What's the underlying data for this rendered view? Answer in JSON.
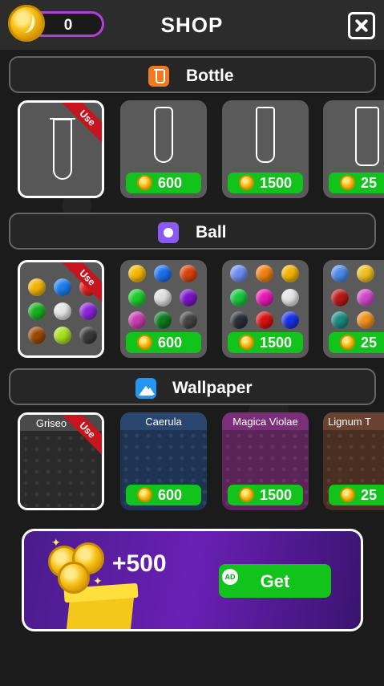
{
  "header": {
    "coin_count": "0",
    "title": "SHOP"
  },
  "sections": {
    "bottle": {
      "label": "Bottle",
      "items": [
        {
          "badge": "Use"
        },
        {
          "price": "600"
        },
        {
          "price": "1500"
        },
        {
          "price": "25"
        }
      ]
    },
    "ball": {
      "label": "Ball",
      "items": [
        {
          "badge": "Use"
        },
        {
          "price": "600"
        },
        {
          "price": "1500"
        },
        {
          "price": "25"
        }
      ]
    },
    "wallpaper": {
      "label": "Wallpaper",
      "items": [
        {
          "name": "Griseo",
          "badge": "Use"
        },
        {
          "name": "Caerula",
          "price": "600"
        },
        {
          "name": "Magica Violae",
          "price": "1500"
        },
        {
          "name": "Lignum T",
          "price": "25"
        }
      ]
    }
  },
  "bonus": {
    "amount": "+500",
    "ad_badge": "AD",
    "button_label": "Get"
  },
  "colors": {
    "accent_green": "#12c31b",
    "ribbon_red": "#c8141e",
    "coin_border": "#b43fd6"
  }
}
